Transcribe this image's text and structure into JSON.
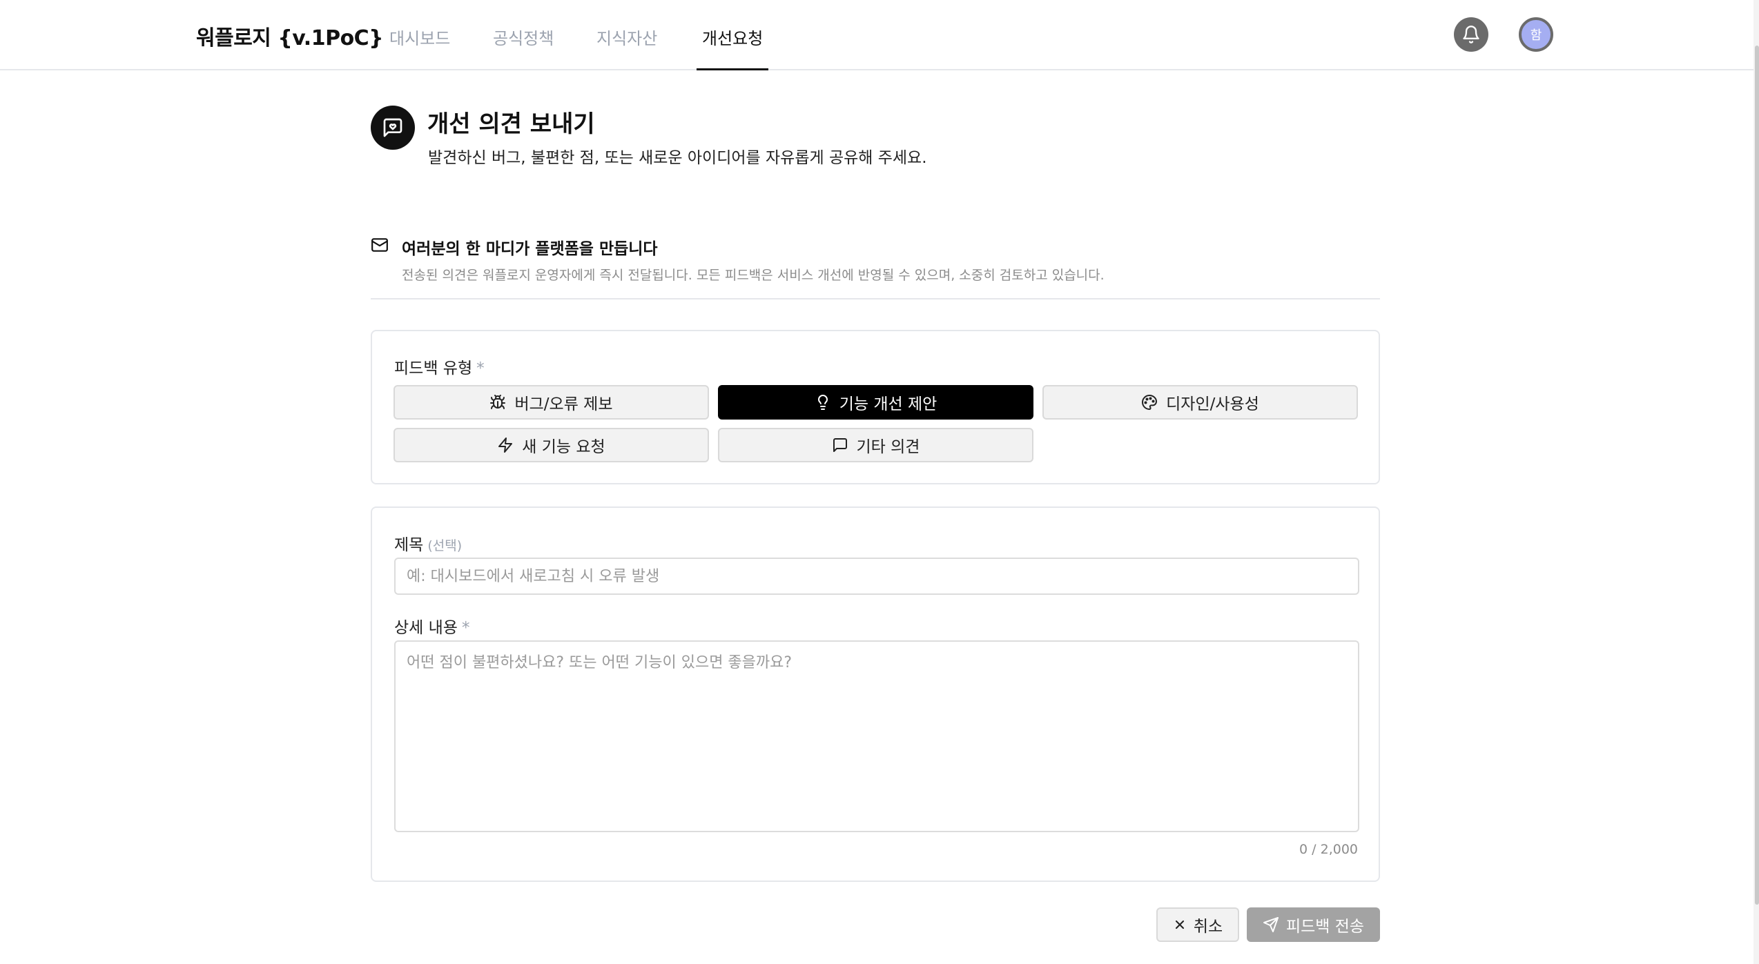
{
  "header": {
    "brand": "워플로지 {v.1PoC}",
    "tabs": [
      {
        "label": "대시보드",
        "active": false
      },
      {
        "label": "공식정책",
        "active": false
      },
      {
        "label": "지식자산",
        "active": false
      },
      {
        "label": "개선요청",
        "active": true
      }
    ],
    "bell_icon": "bell-icon",
    "avatar_initial": "함"
  },
  "page": {
    "icon": "message-heart-icon",
    "title": "개선 의견 보내기",
    "subtitle": "발견하신 버그, 불편한 점, 또는 새로운 아이디어를 자유롭게 공유해 주세요."
  },
  "notice": {
    "icon": "mail-icon",
    "title": "여러분의 한 마디가 플랫폼을 만듭니다",
    "description": "전송된 의견은 워플로지 운영자에게 즉시 전달됩니다. 모든 피드백은 서비스 개선에 반영될 수 있으며, 소중히 검토하고 있습니다."
  },
  "feedback_type": {
    "label": "피드백 유형",
    "required_mark": "*",
    "options": [
      {
        "label": "버그/오류 제보",
        "icon": "bug-icon",
        "selected": false
      },
      {
        "label": "기능 개선 제안",
        "icon": "lightbulb-icon",
        "selected": true
      },
      {
        "label": "디자인/사용성",
        "icon": "palette-icon",
        "selected": false
      },
      {
        "label": "새 기능 요청",
        "icon": "zap-icon",
        "selected": false
      },
      {
        "label": "기타 의견",
        "icon": "message-square-icon",
        "selected": false
      }
    ]
  },
  "form": {
    "title_label": "제목",
    "title_optional": "(선택)",
    "title_value": "",
    "title_placeholder": "예: 대시보드에서 새로고침 시 오류 발생",
    "detail_label": "상세 내용",
    "detail_required_mark": "*",
    "detail_value": "",
    "detail_placeholder": "어떤 점이 불편하셨나요? 또는 어떤 기능이 있으면 좋을까요?",
    "char_count": "0 / 2,000"
  },
  "actions": {
    "cancel_label": "취소",
    "submit_label": "피드백 전송"
  },
  "colors": {
    "selected_bg": "#000000",
    "button_bg": "#f2f2f2",
    "submit_disabled_bg": "#a3a3a3",
    "avatar_bg": "#a5aef2",
    "bell_bg": "#6b6b6b"
  }
}
